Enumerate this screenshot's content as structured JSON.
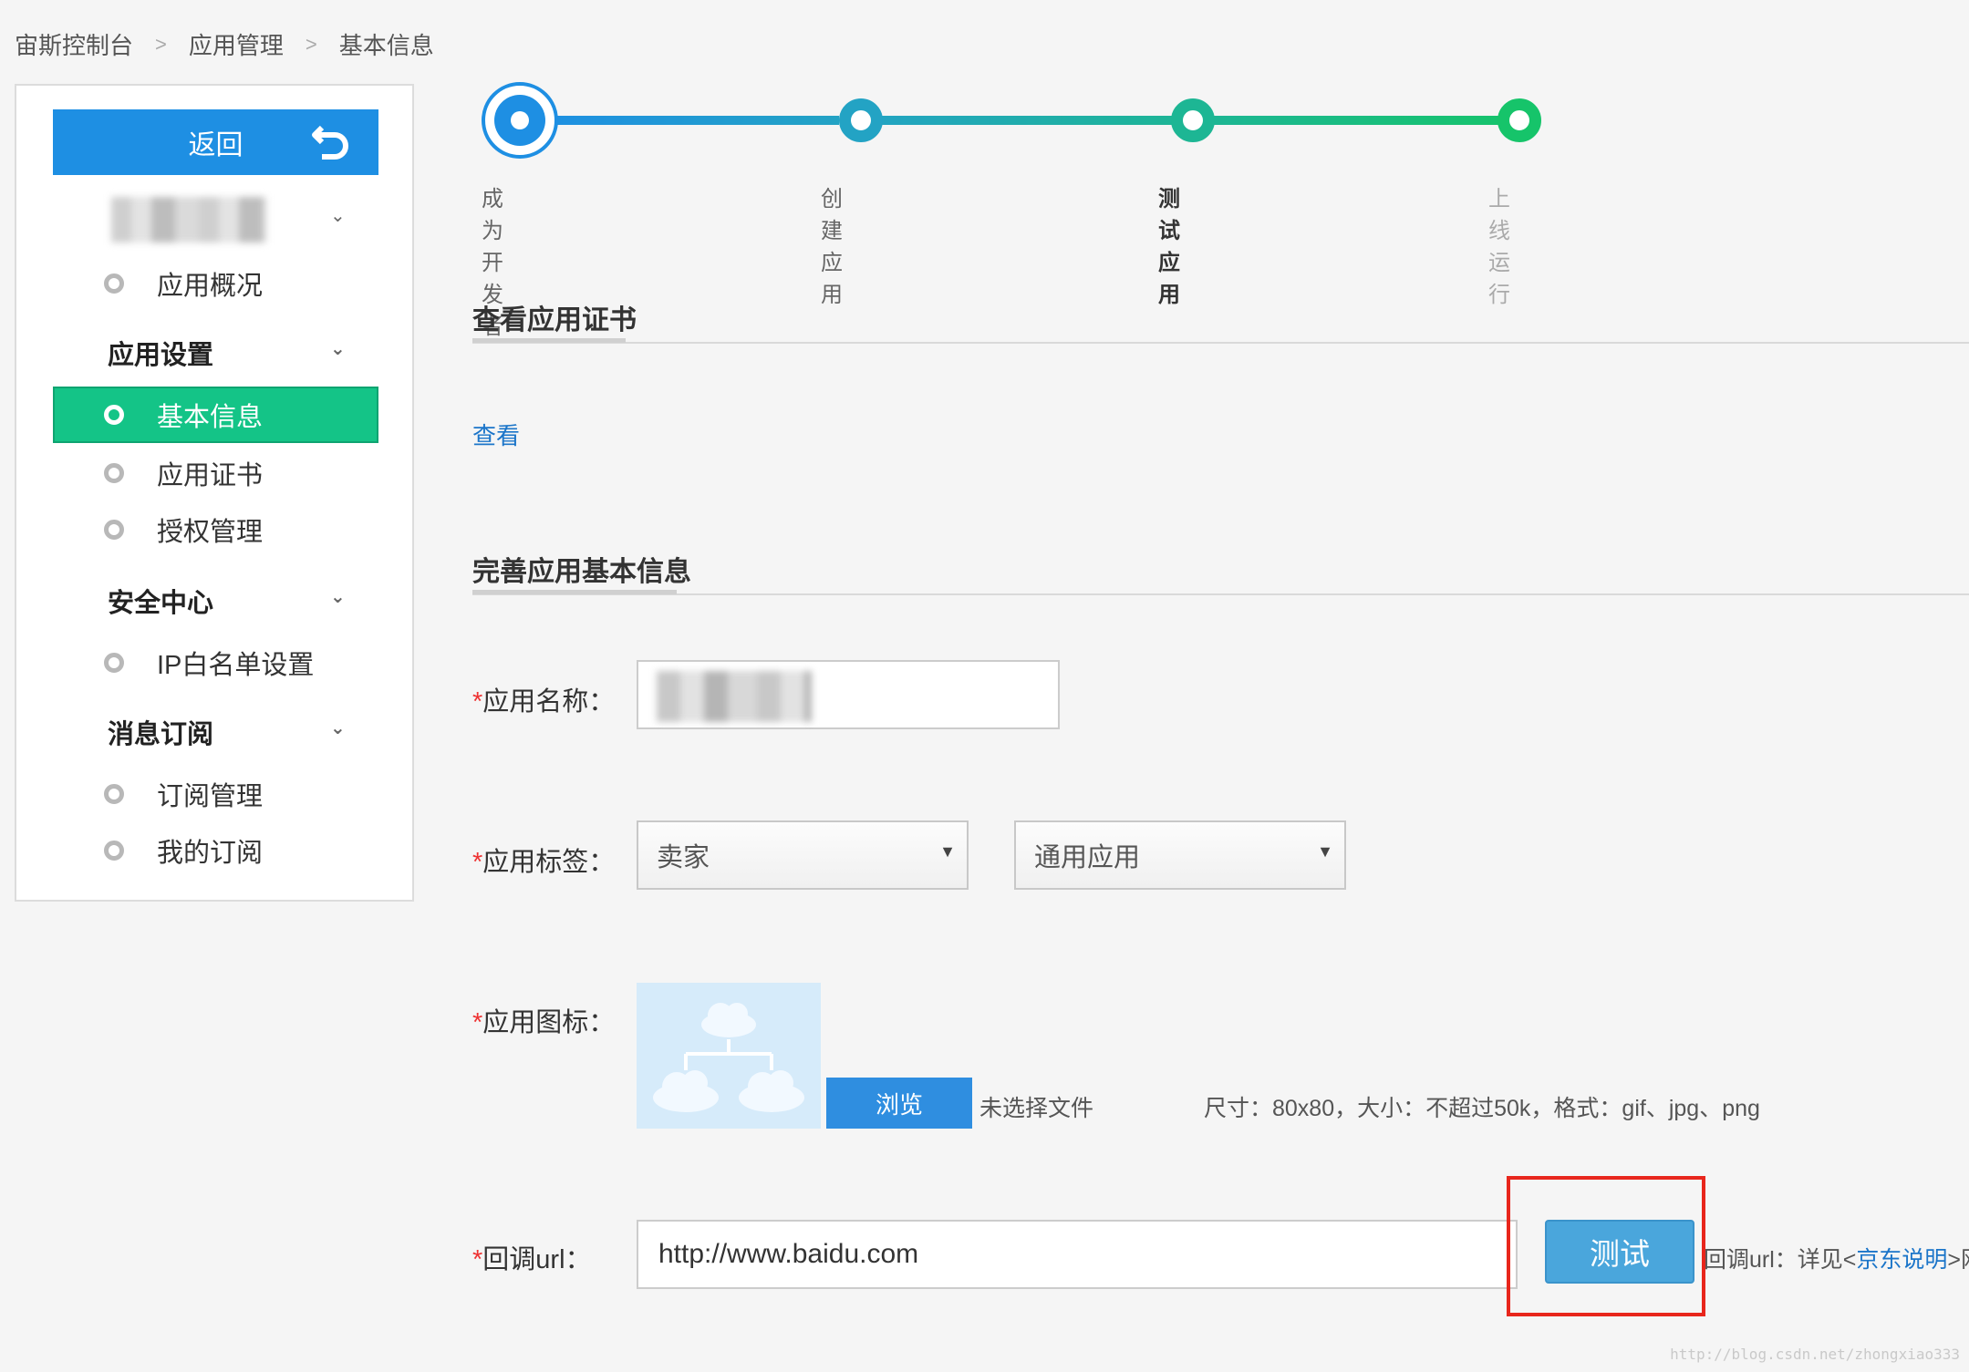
{
  "breadcrumb": {
    "items": [
      "宙斯控制台",
      "应用管理",
      "基本信息"
    ],
    "separator": ">"
  },
  "sidebar": {
    "back_label": "返回",
    "sections": [
      {
        "items": [
          "应用概况"
        ]
      },
      {
        "title": "应用设置",
        "items": [
          "基本信息",
          "应用证书",
          "授权管理"
        ]
      },
      {
        "title": "安全中心",
        "items": [
          "IP白名单设置"
        ]
      },
      {
        "title": "消息订阅",
        "items": [
          "订阅管理",
          "我的订阅"
        ]
      }
    ],
    "active_item": "基本信息",
    "chevron": "chevron-down-icon"
  },
  "steps": [
    "成为开发者",
    "创建应用",
    "测试应用",
    "上线运行"
  ],
  "current_step": "测试应用",
  "certificate": {
    "title": "查看应用证书",
    "view_link": "查看"
  },
  "info": {
    "title": "完善应用基本信息",
    "required_mark": "*",
    "name_label": "应用名称：",
    "tags_label": "应用标签：",
    "tag_primary": "卖家",
    "tag_secondary": "通用应用",
    "icon_label": "应用图标：",
    "browse_label": "浏览",
    "no_file": "未选择文件",
    "icon_hint": "尺寸：80x80，大小：不超过50k，格式：gif、jpg、png",
    "callback_label": "回调url：",
    "callback_value": "http://www.baidu.com",
    "test_label": "测试",
    "callback_hint_prefix": "回调url：详见<",
    "callback_hint_link": "京东说明",
    "callback_hint_suffix": ">网"
  },
  "watermark": "http://blog.csdn.net/zhongxiao333",
  "colors": {
    "primary": "#1e8fe3",
    "active": "#14c487",
    "link": "#1b75c9",
    "highlight": "#e8261c"
  }
}
